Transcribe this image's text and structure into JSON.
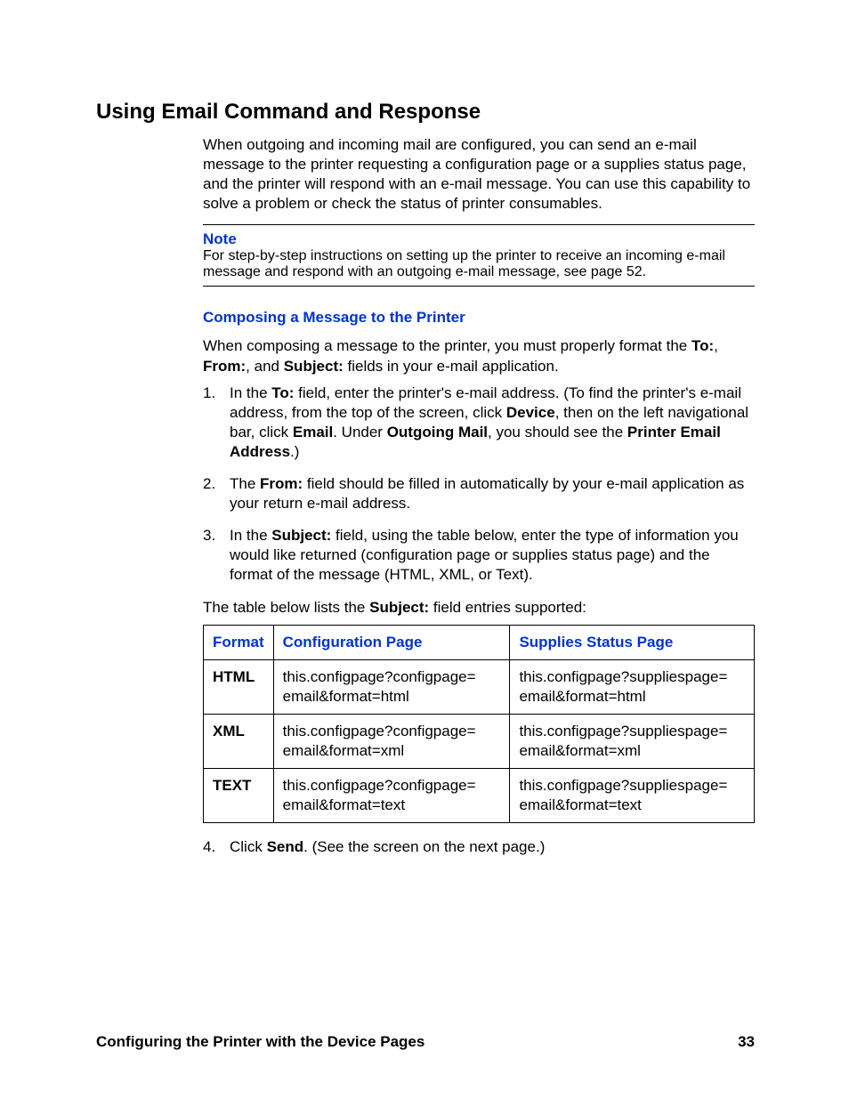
{
  "heading": "Using Email Command and Response",
  "intro": "When outgoing and incoming mail are configured, you can send an e-mail message to the printer requesting a configuration page or a supplies status page, and the printer will respond with an e-mail message. You can use this capability to solve a problem or check the status of printer consumables.",
  "note": {
    "label": "Note",
    "text": "For step-by-step instructions on setting up the printer to receive an incoming e-mail message and respond with an outgoing e-mail message, see page 52."
  },
  "subhead": "Composing a Message to the Printer",
  "compose_intro_parts": {
    "p1": "When composing a message to the printer, you must properly format the ",
    "to": "To:",
    "sep1": ", ",
    "from": "From:",
    "sep2": ", and ",
    "subject": "Subject:",
    "p2": " fields in your e-mail application."
  },
  "steps": {
    "s1": {
      "a": "In the ",
      "b": "To:",
      "c": " field, enter the printer's e-mail address. (To find the printer's e-mail address, from the top of the screen, click ",
      "d": "Device",
      "e": ", then on the left navigational bar, click ",
      "f": "Email",
      "g": ". Under ",
      "h": "Outgoing Mail",
      "i": ", you should see the ",
      "j": "Printer Email Address",
      "k": ".)"
    },
    "s2": {
      "a": "The ",
      "b": "From:",
      "c": " field should be filled in automatically by your e-mail application as your return e-mail address."
    },
    "s3": {
      "a": "In the ",
      "b": "Subject:",
      "c": " field, using the table below, enter the type of information you would like returned (configuration page or supplies status page) and the format of the message (HTML, XML, or Text)."
    },
    "s4": {
      "a": "Click ",
      "b": "Send",
      "c": ". (See the screen on the next page.)"
    }
  },
  "table": {
    "caption_parts": {
      "a": "The table below lists the ",
      "b": "Subject:",
      "c": " field entries supported:"
    },
    "headers": {
      "format": "Format",
      "config": "Configuration Page",
      "supplies": "Supplies Status Page"
    },
    "rows": [
      {
        "format": "HTML",
        "config": "this.configpage?configpage=email&format=html",
        "supplies": "this.configpage?suppliespage=email&format=html"
      },
      {
        "format": "XML",
        "config": "this.configpage?configpage=email&format=xml",
        "supplies": "this.configpage?suppliespage=email&format=xml"
      },
      {
        "format": "TEXT",
        "config": "this.configpage?configpage=email&format=text",
        "supplies": "this.configpage?suppliespage=email&format=text"
      }
    ]
  },
  "footer": {
    "title": "Configuring the Printer with the Device Pages",
    "page": "33"
  }
}
